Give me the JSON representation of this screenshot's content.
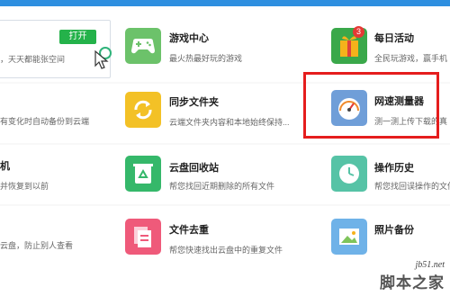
{
  "tiles": {
    "col1_row1": {
      "title": "",
      "desc": "，天天都能张空间",
      "button": "打开"
    },
    "col1_row2": {
      "desc": "有变化时自动备份到云端"
    },
    "col1_row3": {
      "title": "机",
      "desc": "并恢复到以前"
    },
    "col1_row4": {
      "desc": "云盘，防止别人查看"
    },
    "game_center": {
      "title": "游戏中心",
      "desc": "最火热最好玩的游戏",
      "icon": "gamepad-icon",
      "color": "#6cc26a"
    },
    "sync_folder": {
      "title": "同步文件夹",
      "desc": "云端文件夹内容和本地始终保持...",
      "icon": "sync-arrows-icon",
      "color": "#f3c126"
    },
    "recycle_bin": {
      "title": "云盘回收站",
      "desc": "帮您找回近期删除的所有文件",
      "icon": "recycle-bin-icon",
      "color": "#35b86a"
    },
    "dedupe": {
      "title": "文件去重",
      "desc": "帮您快速找出云盘中的重复文件",
      "icon": "duplicate-files-icon",
      "color": "#ef5a7a"
    },
    "daily_event": {
      "title": "每日活动",
      "desc": "全民玩游戏，赢手机",
      "icon": "gift-icon",
      "color": "#3aa84a",
      "badge": "3"
    },
    "speed_test": {
      "title": "网速测量器",
      "desc": "测一测上传下载的真",
      "icon": "speedometer-icon",
      "color": "#6f9ed8"
    },
    "history": {
      "title": "操作历史",
      "desc": "帮您找回误操作的文件",
      "icon": "clock-icon",
      "color": "#56c3a6"
    },
    "photo_backup": {
      "title": "照片备份",
      "desc": "",
      "icon": "photo-icon",
      "color": "#6fb2e8"
    }
  },
  "watermark": {
    "url": "jb51.net",
    "name": "脚本之家"
  }
}
